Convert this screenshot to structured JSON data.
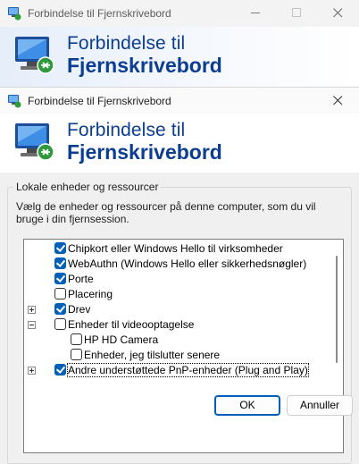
{
  "back_window": {
    "title": "Forbindelse til Fjernskrivebord",
    "banner": {
      "line1": "Forbindelse til",
      "line2": "Fjernskrivebord"
    }
  },
  "dialog": {
    "title": "Forbindelse til Fjernskrivebord",
    "banner": {
      "line1": "Forbindelse til",
      "line2": "Fjernskrivebord"
    },
    "group_title": "Lokale enheder og ressourcer",
    "description": "Vælg de enheder og ressourcer på denne computer, som du vil bruge i din fjernsession.",
    "tree_items": [
      {
        "label": "Chipkort eller Windows Hello til virksomheder",
        "checked": true
      },
      {
        "label": "WebAuthn (Windows Hello eller sikkerhedsnøgler)",
        "checked": true
      },
      {
        "label": "Porte",
        "checked": true
      },
      {
        "label": "Placering",
        "checked": false
      },
      {
        "label": "Drev",
        "checked": true,
        "expander": "plus"
      },
      {
        "label": "Enheder til videooptagelse",
        "checked": false,
        "expander": "minus"
      },
      {
        "label": "HP HD Camera",
        "checked": false
      },
      {
        "label": "Enheder, jeg tilslutter senere",
        "checked": false
      },
      {
        "label": "Andre understøttede PnP-enheder (Plug and Play)",
        "checked": true,
        "expander": "plus"
      }
    ],
    "ok_label": "OK",
    "cancel_label": "Annuller"
  },
  "colors": {
    "accent": "#005fb8",
    "banner_text": "#0b3d91"
  },
  "icons": [
    "remote-desktop-icon",
    "minimize-icon",
    "maximize-icon",
    "close-icon"
  ]
}
